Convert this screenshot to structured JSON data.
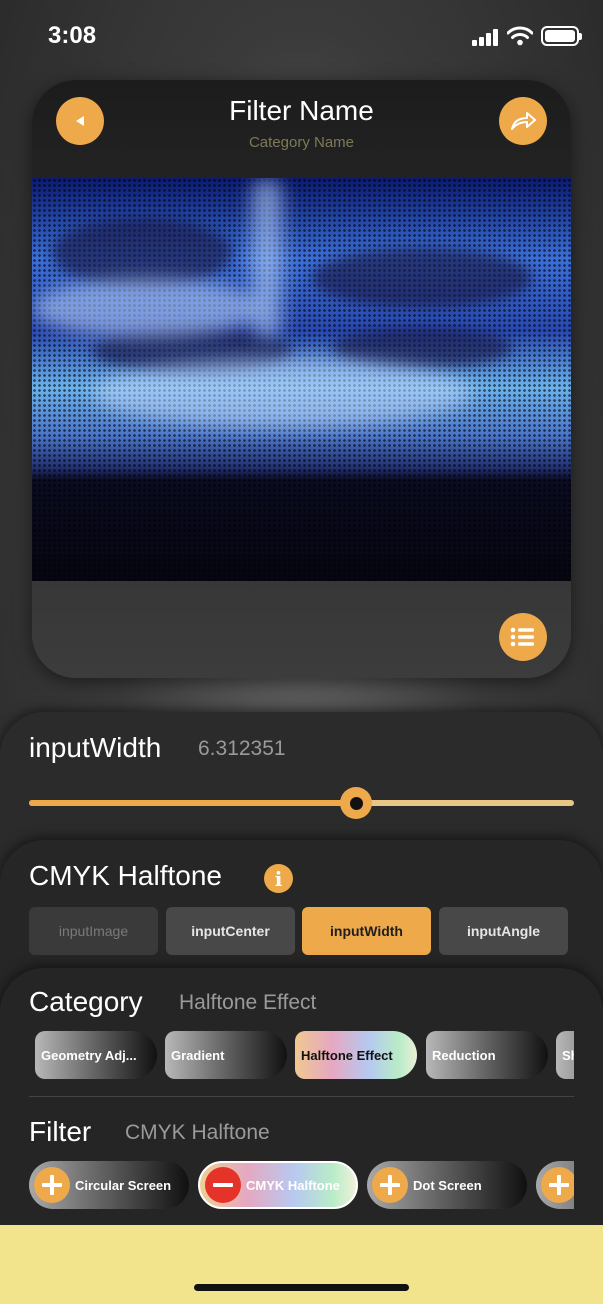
{
  "status": {
    "time": "3:08"
  },
  "header": {
    "title": "Filter Name",
    "category": "Category Name"
  },
  "icons": {
    "back": "back-arrow-icon",
    "share": "share-icon",
    "menu": "list-menu-icon",
    "info": "info-icon"
  },
  "slider": {
    "label": "inputWidth",
    "value": "6.312351",
    "fraction": 0.6
  },
  "params": {
    "title": "CMYK Halftone",
    "buttons": [
      {
        "label": "inputImage",
        "state": "disabled"
      },
      {
        "label": "inputCenter",
        "state": "normal"
      },
      {
        "label": "inputWidth",
        "state": "selected"
      },
      {
        "label": "inputAngle",
        "state": "normal"
      }
    ]
  },
  "category": {
    "label": "Category",
    "selected": "Halftone Effect",
    "items": [
      "Geometry Adj...",
      "Gradient",
      "Halftone Effect",
      "Reduction",
      "Sh"
    ]
  },
  "filter": {
    "label": "Filter",
    "selected": "CMYK Halftone",
    "items": [
      "Circular Screen",
      "CMYK Halftone",
      "Dot Screen",
      ""
    ]
  },
  "colors": {
    "accent": "#EEA94A",
    "remove": "#E5332A",
    "bottom_bar": "#F2E48C"
  }
}
